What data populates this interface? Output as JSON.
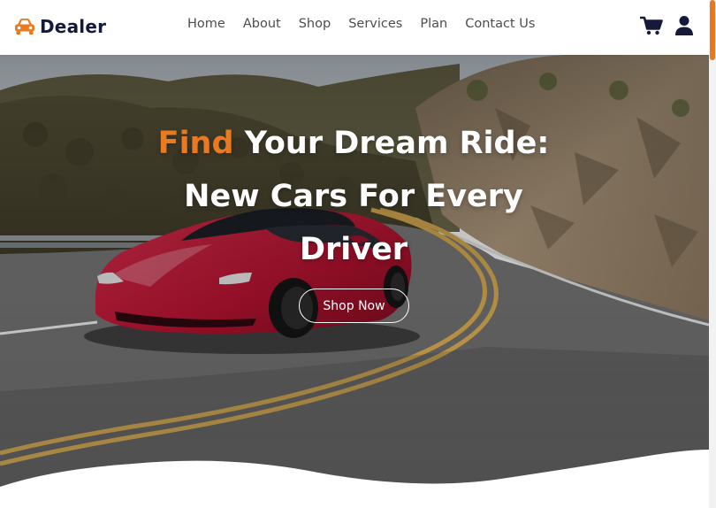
{
  "brand": {
    "name": "Dealer",
    "icon": "car-icon",
    "icon_color": "#ea7a22"
  },
  "nav": {
    "items": [
      {
        "label": "Home"
      },
      {
        "label": "About"
      },
      {
        "label": "Shop"
      },
      {
        "label": "Services"
      },
      {
        "label": "Plan"
      },
      {
        "label": "Contact Us"
      }
    ]
  },
  "header_icons": {
    "cart": "cart-icon",
    "user": "user-icon",
    "color": "#161a3a"
  },
  "hero": {
    "title_accent": "Find",
    "title_rest": " Your Dream Ride: New Cars For Every Driver",
    "cta_label": "Shop Now",
    "background": "red-sports-car-on-mountain-road-image"
  },
  "colors": {
    "accent": "#ea7a22",
    "brand_dark": "#161a3a",
    "nav_text": "#4d4d4d"
  }
}
